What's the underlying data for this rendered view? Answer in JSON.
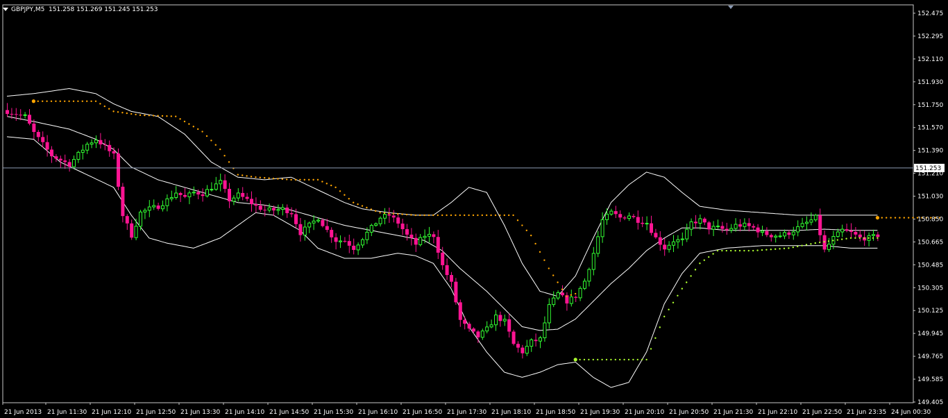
{
  "header": {
    "symbol_timeframe": "GBPJPY,M5",
    "ohlc": "151.258 151.269 151.245 151.253"
  },
  "colors": {
    "background": "#000000",
    "frame": "#c8c8c8",
    "bull_candle": "#32ff32",
    "bear_candle": "#ff1493",
    "bands": "#ffffff",
    "stop_resistance": "#ffa500",
    "stop_support": "#adff2f",
    "price_line": "#8c9bb4",
    "price_label_bg": "#ffffff",
    "price_label_text": "#000000"
  },
  "chart_data": {
    "type": "candlestick",
    "indicators": [
      "bollinger-bands",
      "trailing-stop"
    ],
    "ylim": [
      149.405,
      152.53
    ],
    "y_ticks": [
      "152.475",
      "152.295",
      "152.110",
      "151.930",
      "151.750",
      "151.570",
      "151.390",
      "151.210",
      "151.030",
      "150.850",
      "150.665",
      "150.485",
      "150.305",
      "150.125",
      "149.945",
      "149.765",
      "149.585",
      "149.405"
    ],
    "x_ticks": [
      "21 Jun 2013",
      "21 Jun 11:30",
      "21 Jun 12:10",
      "21 Jun 12:50",
      "21 Jun 13:30",
      "21 Jun 14:10",
      "21 Jun 14:50",
      "21 Jun 15:30",
      "21 Jun 16:10",
      "21 Jun 16:50",
      "21 Jun 17:30",
      "21 Jun 18:10",
      "21 Jun 18:50",
      "21 Jun 19:30",
      "21 Jun 20:10",
      "21 Jun 20:50",
      "21 Jun 21:30",
      "21 Jun 22:10",
      "21 Jun 22:50",
      "21 Jun 23:35",
      "24 Jun 00:30"
    ],
    "current_price": 151.253,
    "current_price_label": "151.253",
    "close_anchors": [
      [
        0,
        151.7
      ],
      [
        4,
        151.66
      ],
      [
        6,
        151.53
      ],
      [
        10,
        151.35
      ],
      [
        14,
        151.28
      ],
      [
        18,
        151.44
      ],
      [
        20,
        151.48
      ],
      [
        22,
        151.42
      ],
      [
        24,
        151.35
      ],
      [
        26,
        150.88
      ],
      [
        28,
        150.72
      ],
      [
        30,
        150.9
      ],
      [
        32,
        150.93
      ],
      [
        34,
        150.95
      ],
      [
        36,
        151.0
      ],
      [
        38,
        151.06
      ],
      [
        40,
        151.02
      ],
      [
        42,
        151.06
      ],
      [
        44,
        151.05
      ],
      [
        46,
        151.1
      ],
      [
        48,
        151.14
      ],
      [
        50,
        151.0
      ],
      [
        52,
        151.04
      ],
      [
        54,
        151.0
      ],
      [
        56,
        150.95
      ],
      [
        58,
        150.92
      ],
      [
        60,
        150.92
      ],
      [
        62,
        150.93
      ],
      [
        64,
        150.9
      ],
      [
        66,
        150.74
      ],
      [
        68,
        150.8
      ],
      [
        70,
        150.86
      ],
      [
        72,
        150.76
      ],
      [
        74,
        150.68
      ],
      [
        76,
        150.68
      ],
      [
        78,
        150.62
      ],
      [
        80,
        150.7
      ],
      [
        82,
        150.78
      ],
      [
        84,
        150.86
      ],
      [
        86,
        150.88
      ],
      [
        88,
        150.82
      ],
      [
        90,
        150.72
      ],
      [
        92,
        150.65
      ],
      [
        94,
        150.72
      ],
      [
        96,
        150.72
      ],
      [
        98,
        150.48
      ],
      [
        100,
        150.34
      ],
      [
        102,
        150.05
      ],
      [
        104,
        149.97
      ],
      [
        106,
        149.92
      ],
      [
        108,
        149.98
      ],
      [
        110,
        150.08
      ],
      [
        112,
        150.04
      ],
      [
        114,
        149.86
      ],
      [
        116,
        149.8
      ],
      [
        118,
        149.88
      ],
      [
        120,
        149.9
      ],
      [
        122,
        150.16
      ],
      [
        124,
        150.26
      ],
      [
        126,
        150.2
      ],
      [
        128,
        150.24
      ],
      [
        130,
        150.36
      ],
      [
        132,
        150.58
      ],
      [
        134,
        150.84
      ],
      [
        136,
        150.9
      ],
      [
        138,
        150.86
      ],
      [
        140,
        150.88
      ],
      [
        142,
        150.84
      ],
      [
        144,
        150.82
      ],
      [
        146,
        150.7
      ],
      [
        148,
        150.62
      ],
      [
        150,
        150.68
      ],
      [
        152,
        150.68
      ],
      [
        154,
        150.82
      ],
      [
        156,
        150.84
      ],
      [
        158,
        150.78
      ],
      [
        160,
        150.78
      ],
      [
        162,
        150.76
      ],
      [
        164,
        150.8
      ],
      [
        166,
        150.8
      ],
      [
        168,
        150.78
      ],
      [
        170,
        150.74
      ],
      [
        172,
        150.72
      ],
      [
        174,
        150.72
      ],
      [
        176,
        150.74
      ],
      [
        178,
        150.78
      ],
      [
        180,
        150.82
      ],
      [
        182,
        150.86
      ],
      [
        184,
        150.6
      ],
      [
        186,
        150.7
      ],
      [
        188,
        150.76
      ],
      [
        190,
        150.74
      ],
      [
        192,
        150.7
      ],
      [
        194,
        150.7
      ],
      [
        196,
        150.72
      ]
    ],
    "upper_band_anchors": [
      [
        0,
        151.82
      ],
      [
        6,
        151.84
      ],
      [
        14,
        151.88
      ],
      [
        20,
        151.84
      ],
      [
        24,
        151.76
      ],
      [
        28,
        151.7
      ],
      [
        34,
        151.66
      ],
      [
        40,
        151.52
      ],
      [
        46,
        151.3
      ],
      [
        52,
        151.18
      ],
      [
        58,
        151.16
      ],
      [
        64,
        151.18
      ],
      [
        70,
        151.08
      ],
      [
        76,
        150.98
      ],
      [
        80,
        150.93
      ],
      [
        86,
        150.9
      ],
      [
        92,
        150.88
      ],
      [
        96,
        150.88
      ],
      [
        100,
        150.98
      ],
      [
        104,
        151.1
      ],
      [
        108,
        151.06
      ],
      [
        112,
        150.8
      ],
      [
        116,
        150.5
      ],
      [
        120,
        150.28
      ],
      [
        124,
        150.24
      ],
      [
        128,
        150.4
      ],
      [
        132,
        150.7
      ],
      [
        136,
        150.98
      ],
      [
        140,
        151.12
      ],
      [
        144,
        151.22
      ],
      [
        148,
        151.18
      ],
      [
        152,
        151.06
      ],
      [
        156,
        150.95
      ],
      [
        162,
        150.92
      ],
      [
        170,
        150.9
      ],
      [
        178,
        150.88
      ],
      [
        184,
        150.88
      ],
      [
        190,
        150.88
      ],
      [
        196,
        150.88
      ]
    ],
    "middle_band_anchors": [
      [
        0,
        151.66
      ],
      [
        6,
        151.62
      ],
      [
        14,
        151.56
      ],
      [
        20,
        151.48
      ],
      [
        24,
        151.4
      ],
      [
        28,
        151.26
      ],
      [
        34,
        151.16
      ],
      [
        40,
        151.1
      ],
      [
        46,
        151.04
      ],
      [
        52,
        150.98
      ],
      [
        58,
        150.96
      ],
      [
        64,
        150.92
      ],
      [
        70,
        150.86
      ],
      [
        76,
        150.8
      ],
      [
        82,
        150.76
      ],
      [
        88,
        150.72
      ],
      [
        94,
        150.68
      ],
      [
        98,
        150.6
      ],
      [
        102,
        150.46
      ],
      [
        108,
        150.28
      ],
      [
        112,
        150.14
      ],
      [
        116,
        150.0
      ],
      [
        120,
        149.97
      ],
      [
        124,
        149.98
      ],
      [
        128,
        150.06
      ],
      [
        132,
        150.2
      ],
      [
        136,
        150.34
      ],
      [
        140,
        150.46
      ],
      [
        144,
        150.6
      ],
      [
        148,
        150.7
      ],
      [
        152,
        150.78
      ],
      [
        156,
        150.78
      ],
      [
        162,
        150.76
      ],
      [
        170,
        150.76
      ],
      [
        178,
        150.76
      ],
      [
        184,
        150.77
      ],
      [
        190,
        150.76
      ],
      [
        196,
        150.76
      ]
    ],
    "lower_band_anchors": [
      [
        0,
        151.5
      ],
      [
        6,
        151.48
      ],
      [
        12,
        151.3
      ],
      [
        18,
        151.2
      ],
      [
        24,
        151.1
      ],
      [
        28,
        150.88
      ],
      [
        32,
        150.7
      ],
      [
        36,
        150.66
      ],
      [
        42,
        150.62
      ],
      [
        48,
        150.7
      ],
      [
        52,
        150.8
      ],
      [
        56,
        150.9
      ],
      [
        60,
        150.88
      ],
      [
        66,
        150.76
      ],
      [
        70,
        150.62
      ],
      [
        76,
        150.54
      ],
      [
        82,
        150.54
      ],
      [
        88,
        150.58
      ],
      [
        92,
        150.56
      ],
      [
        96,
        150.5
      ],
      [
        100,
        150.3
      ],
      [
        104,
        150.0
      ],
      [
        108,
        149.8
      ],
      [
        112,
        149.64
      ],
      [
        116,
        149.6
      ],
      [
        120,
        149.64
      ],
      [
        124,
        149.7
      ],
      [
        128,
        149.72
      ],
      [
        132,
        149.6
      ],
      [
        136,
        149.52
      ],
      [
        140,
        149.56
      ],
      [
        144,
        149.8
      ],
      [
        148,
        150.18
      ],
      [
        152,
        150.42
      ],
      [
        156,
        150.58
      ],
      [
        162,
        150.62
      ],
      [
        170,
        150.64
      ],
      [
        178,
        150.64
      ],
      [
        184,
        150.64
      ],
      [
        190,
        150.62
      ],
      [
        196,
        150.62
      ]
    ],
    "stop_segments": [
      {
        "kind": "resistance",
        "start": 6,
        "points": [
          [
            6,
            151.78
          ],
          [
            20,
            151.78
          ],
          [
            24,
            151.7
          ],
          [
            30,
            151.67
          ],
          [
            38,
            151.66
          ],
          [
            44,
            151.54
          ],
          [
            48,
            151.4
          ],
          [
            52,
            151.2
          ],
          [
            56,
            151.18
          ],
          [
            64,
            151.16
          ],
          [
            70,
            151.16
          ],
          [
            74,
            151.1
          ],
          [
            78,
            150.98
          ],
          [
            84,
            150.9
          ],
          [
            92,
            150.88
          ],
          [
            98,
            150.88
          ],
          [
            104,
            150.88
          ],
          [
            114,
            150.88
          ],
          [
            118,
            150.72
          ],
          [
            122,
            150.46
          ],
          [
            126,
            150.24
          ],
          [
            128,
            150.26
          ]
        ]
      },
      {
        "kind": "support",
        "start": 128,
        "points": [
          [
            128,
            149.74
          ],
          [
            140,
            149.74
          ],
          [
            144,
            149.74
          ],
          [
            148,
            150.08
          ],
          [
            152,
            150.3
          ],
          [
            156,
            150.5
          ],
          [
            160,
            150.6
          ],
          [
            168,
            150.6
          ],
          [
            176,
            150.62
          ],
          [
            182,
            150.66
          ],
          [
            190,
            150.7
          ],
          [
            196,
            150.7
          ]
        ]
      },
      {
        "kind": "resistance",
        "start": 196,
        "points": [
          [
            196,
            150.86
          ],
          [
            210,
            150.86
          ]
        ]
      }
    ]
  }
}
